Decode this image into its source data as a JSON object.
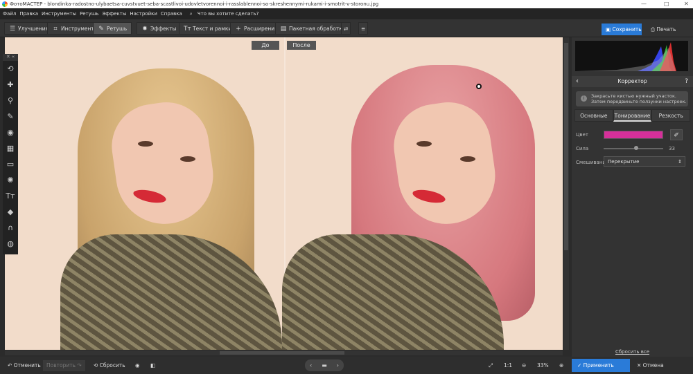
{
  "window": {
    "title": "ФотоМАСТЕР - blondinka-radostno-ulybaetsa-cuvstvuet-seba-scastlivoi-udovletvorennoi-i-rasslablennoi-so-skreshennymi-rukami-i-smotrit-v-storonu.jpg",
    "min": "—",
    "max": "□",
    "close": "✕"
  },
  "menu": {
    "items": [
      "Файл",
      "Правка",
      "Инструменты",
      "Ретушь",
      "Эффекты",
      "Настройки",
      "Справка"
    ],
    "search_placeholder": "Что вы хотите сделать?"
  },
  "toolbar": {
    "tabs": [
      "Улучшения",
      "Инструменты",
      "Ретушь",
      "Эффекты",
      "Текст и рамки",
      "Расширения"
    ],
    "batch": "Пакетная обработка",
    "save": "Сохранить",
    "print": "Печать"
  },
  "canvas": {
    "before": "До",
    "after": "После"
  },
  "panel": {
    "title": "Корректор",
    "hint": [
      "Закрасьте кистью нужный участок.",
      "Затем передвиньте ползунки настроек."
    ],
    "tabs": [
      "Основные",
      "Тонирование",
      "Резкость"
    ],
    "color_label": "Цвет",
    "color_value": "#d6309a",
    "strength_label": "Сила",
    "strength_value": "33",
    "blend_label": "Смешивание",
    "blend_value": "Перекрытие",
    "reset_all": "Сбросить все"
  },
  "bottom": {
    "undo": "Отменить",
    "redo": "Повторить",
    "reset": "Сбросить",
    "ratio": "1:1",
    "zoom": "33%",
    "apply": "Применить",
    "cancel": "Отмена"
  }
}
